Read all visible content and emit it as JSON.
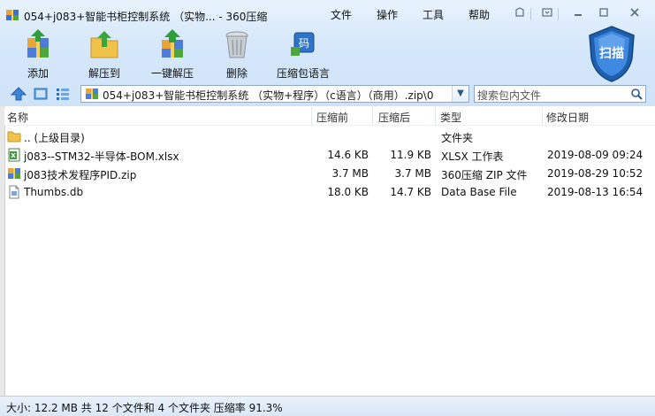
{
  "window": {
    "title": "054+j083+智能书柜控制系统 （实物... - 360压缩",
    "menu": [
      "文件",
      "操作",
      "工具",
      "帮助"
    ]
  },
  "toolbar": {
    "add": "添加",
    "extract_to": "解压到",
    "one_click_extract": "一键解压",
    "delete": "删除",
    "archive_language": "压缩包语言",
    "scan": "扫描"
  },
  "address": {
    "path": "054+j083+智能书柜控制系统 （实物+程序）（c语言）（商用）.zip\\0",
    "search_placeholder": "搜索包内文件"
  },
  "columns": {
    "name": "名称",
    "original": "压缩前",
    "compressed": "压缩后",
    "type": "类型",
    "modified": "修改日期"
  },
  "files": [
    {
      "name": ".. (上级目录)",
      "original": "",
      "compressed": "",
      "type": "文件夹",
      "modified": "",
      "icon": "folder-icon"
    },
    {
      "name": "j083--STM32-半导体-BOM.xlsx",
      "original": "14.6 KB",
      "compressed": "11.9 KB",
      "type": "XLSX 工作表",
      "modified": "2019-08-09 09:24",
      "icon": "excel-icon"
    },
    {
      "name": "j083技术发程序PID.zip",
      "original": "3.7 MB",
      "compressed": "3.7 MB",
      "type": "360压缩 ZIP 文件",
      "modified": "2019-08-29 10:52",
      "icon": "zip-icon"
    },
    {
      "name": "Thumbs.db",
      "original": "18.0 KB",
      "compressed": "14.7 KB",
      "type": "Data Base File",
      "modified": "2019-08-13 16:54",
      "icon": "db-file-icon"
    }
  ],
  "status": {
    "text": "大小: 12.2 MB 共 12 个文件和 4 个文件夹 压缩率 91.3%"
  }
}
